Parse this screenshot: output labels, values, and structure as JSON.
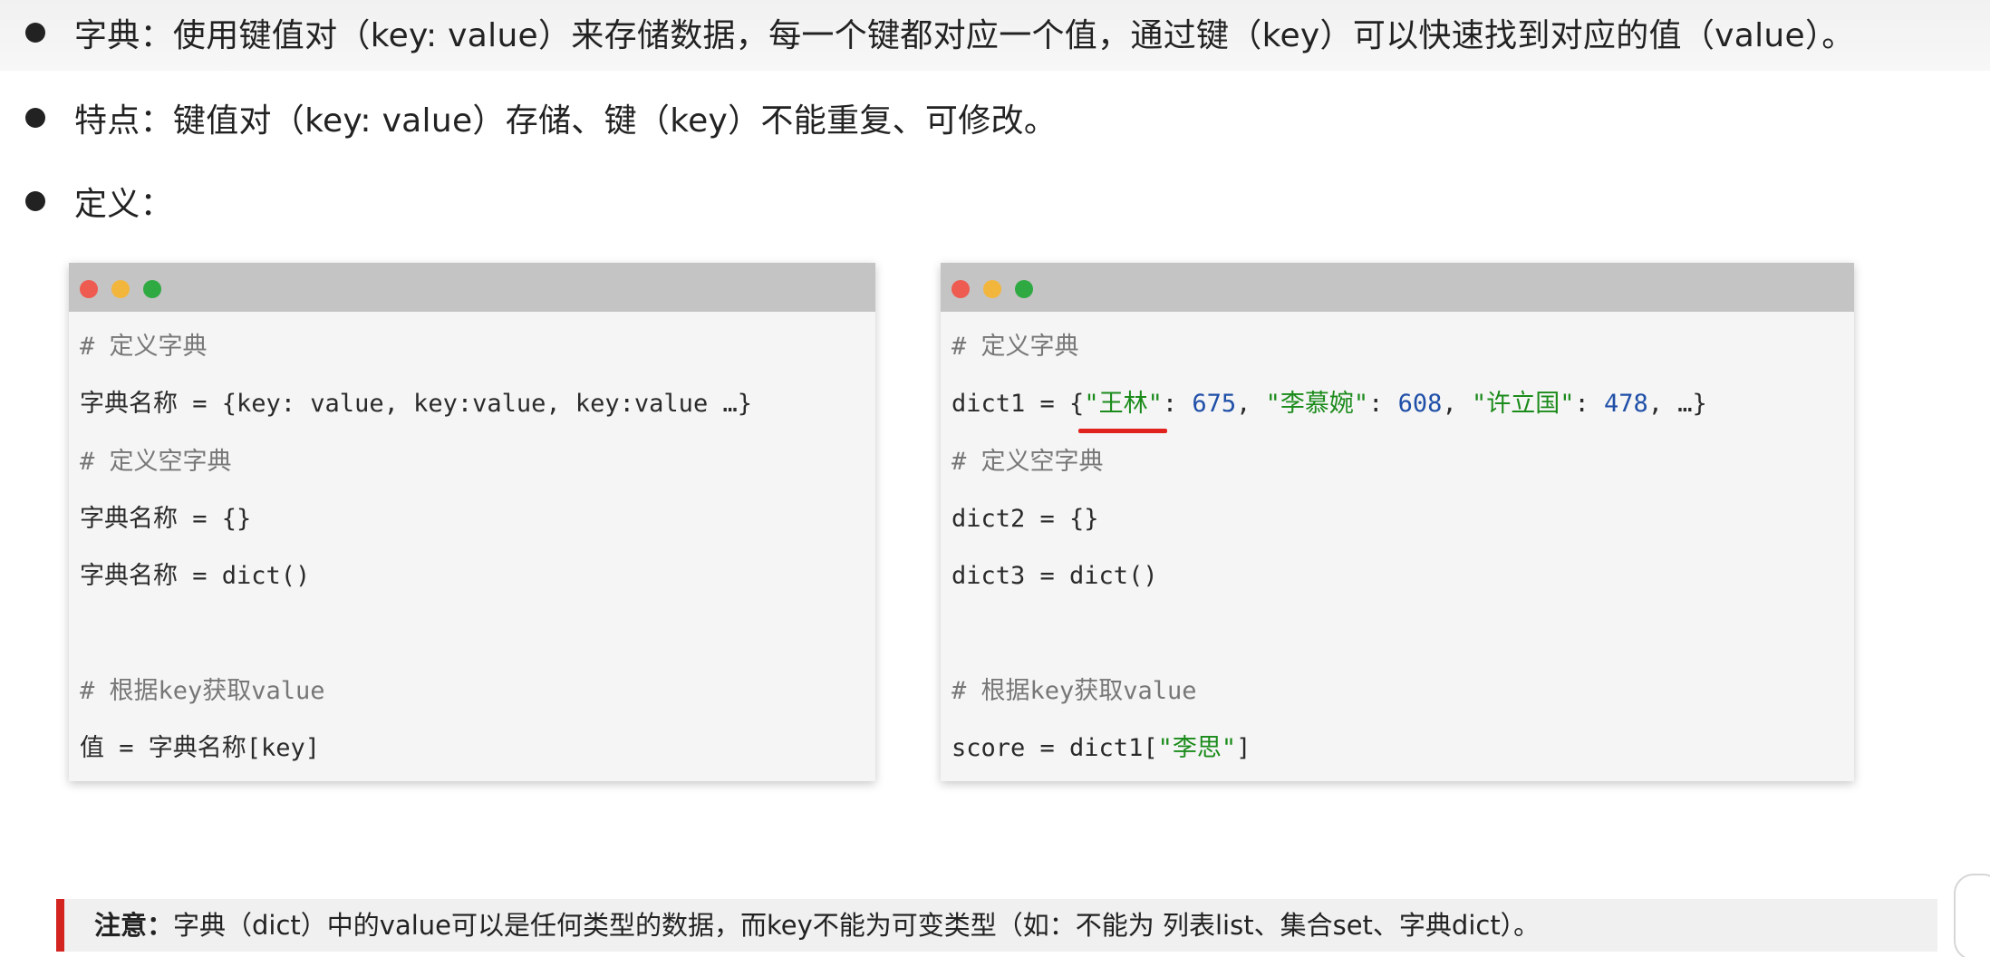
{
  "bullets": [
    {
      "text": "字典：使用键值对（key: value）来存储数据，每一个键都对应一个值，通过键（key）可以快速找到对应的值（value）。"
    },
    {
      "text": "特点：键值对（key: value）存储、键（key）不能重复、可修改。"
    },
    {
      "text": "定义："
    }
  ],
  "left_code": {
    "comment_define": "# 定义字典",
    "line_define": "字典名称 = {key: value, key:value, key:value …}",
    "comment_empty": "# 定义空字典",
    "line_empty1": "字典名称 = {}",
    "line_empty2": "字典名称 = dict()",
    "comment_get": "# 根据key获取value",
    "line_get": "值 = 字典名称[key]"
  },
  "right_code": {
    "comment_define": "# 定义字典",
    "dict1_prefix": "dict1 = {",
    "key1": "\"王林\"",
    "sep1": ": ",
    "val1": "675",
    "comma1": ", ",
    "key2": "\"李慕婉\"",
    "sep2": ": ",
    "val2": "608",
    "comma2": ", ",
    "key3": "\"许立国\"",
    "sep3": ": ",
    "val3": "478",
    "tail": ", …}",
    "comment_empty": "# 定义空字典",
    "line_dict2": "dict2 = {}",
    "line_dict3": "dict3 = dict()",
    "comment_get": "# 根据key获取value",
    "score_prefix": "score = dict1[",
    "score_key": "\"李思\"",
    "score_suffix": "]"
  },
  "note": {
    "label": "注意：",
    "text": "字典（dict）中的value可以是任何类型的数据，而key不能为可变类型（如：不能为 列表list、集合set、字典dict）。"
  },
  "colors": {
    "string": "#1b8b1b",
    "number": "#1f4fa8",
    "comment": "#777777",
    "accent_red": "#d32420",
    "titlebar": "#c4c4c4"
  }
}
